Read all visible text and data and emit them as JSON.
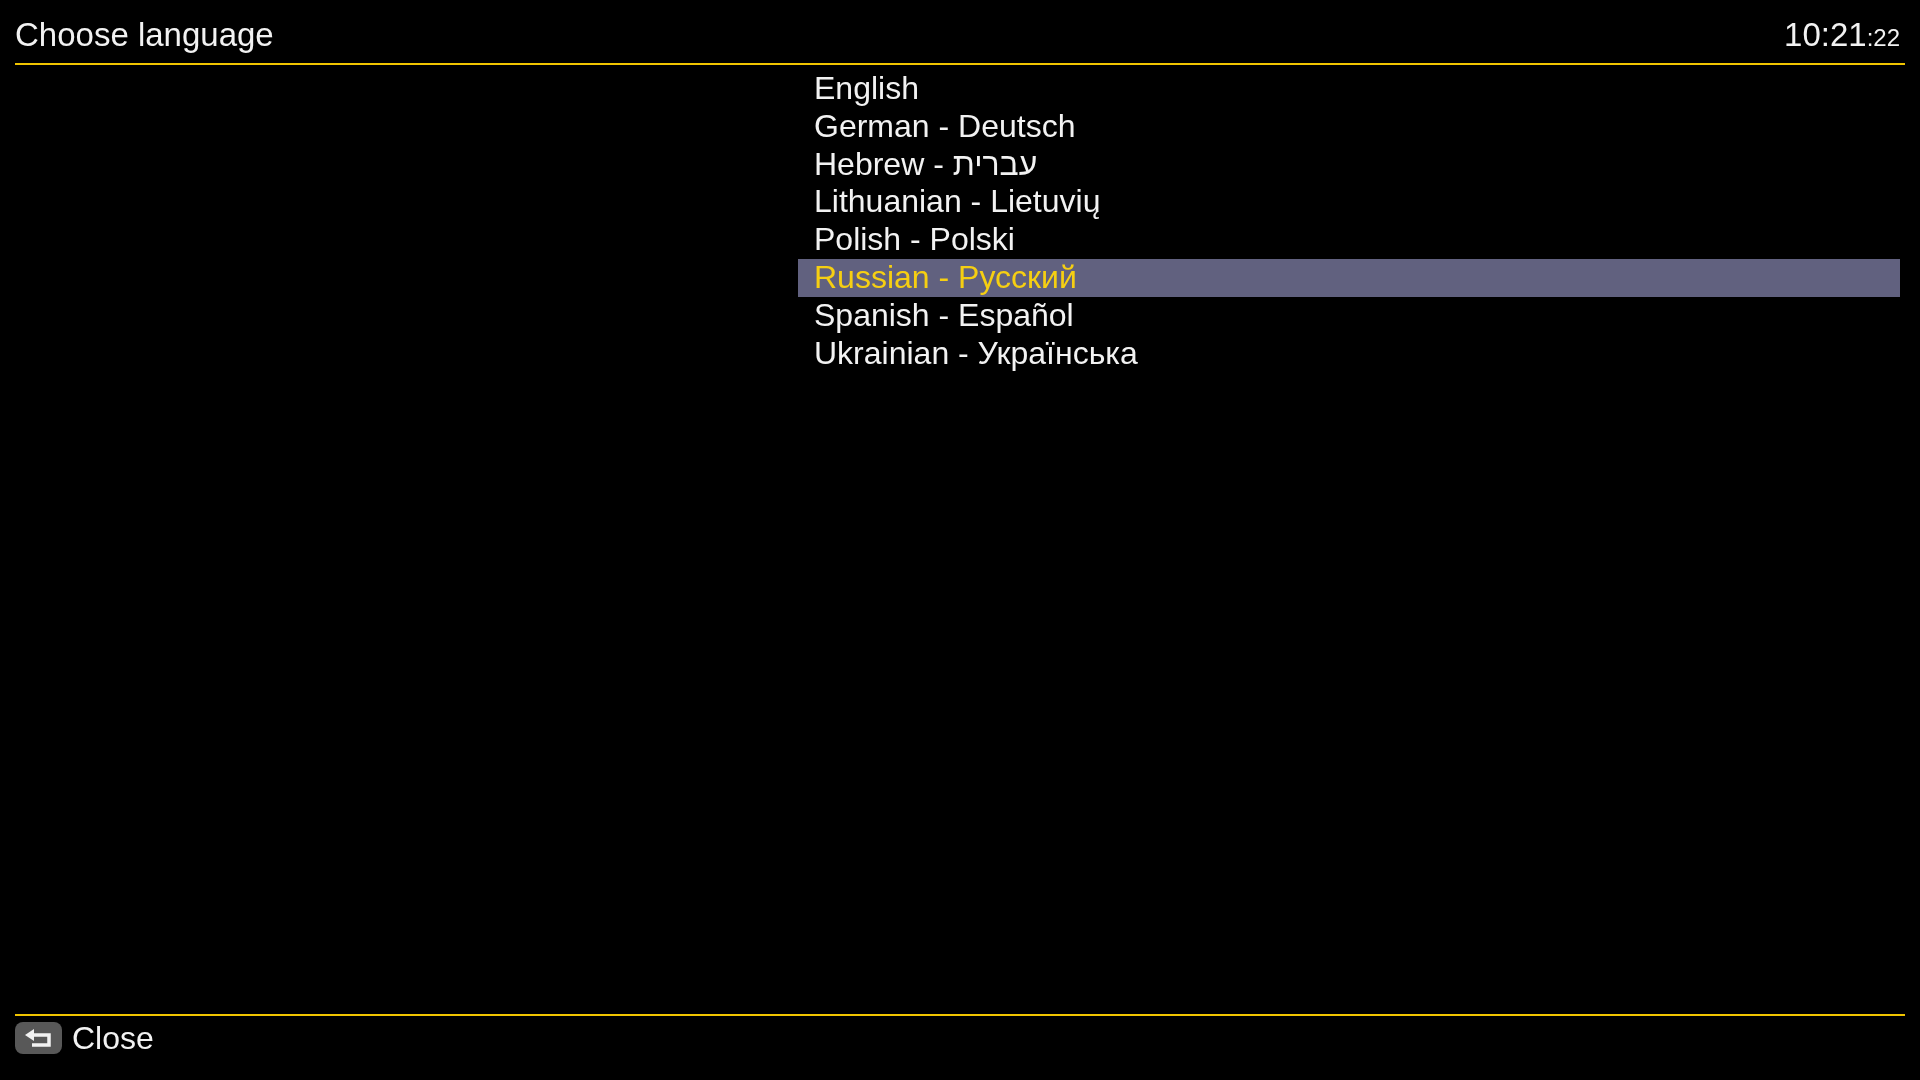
{
  "header": {
    "title": "Choose language",
    "clock": {
      "time": "10:21",
      "seconds": ":22"
    }
  },
  "languages": [
    {
      "label": "English",
      "selected": false
    },
    {
      "label": "German - Deutsch",
      "selected": false
    },
    {
      "label": "Hebrew - עברית",
      "selected": false
    },
    {
      "label": "Lithuanian - Lietuvių",
      "selected": false
    },
    {
      "label": "Polish - Polski",
      "selected": false
    },
    {
      "label": "Russian - Русский",
      "selected": true
    },
    {
      "label": "Spanish - Español",
      "selected": false
    },
    {
      "label": "Ukrainian - Українська",
      "selected": false
    }
  ],
  "footer": {
    "close_label": "Close"
  }
}
